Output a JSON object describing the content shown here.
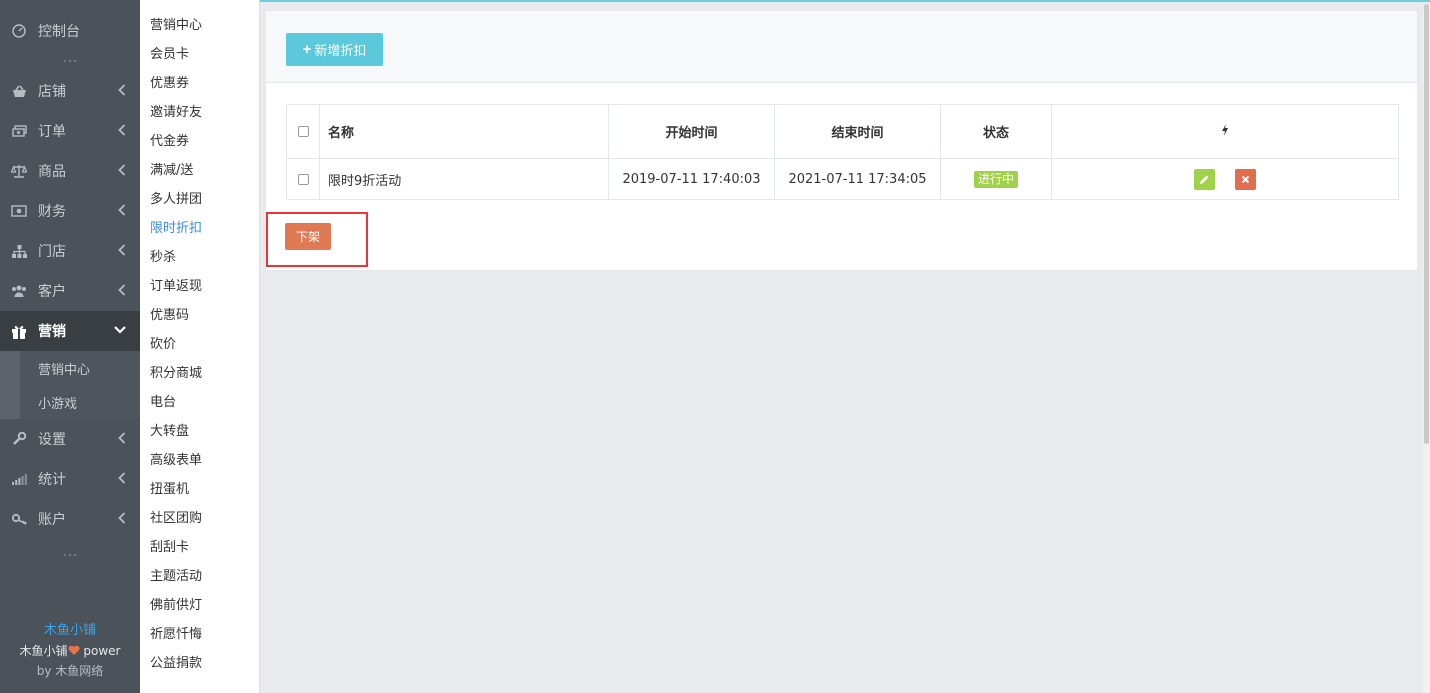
{
  "sidebar": {
    "top_item": {
      "label": "控制台",
      "icon": "dashboard-icon"
    },
    "items": [
      {
        "label": "店铺",
        "icon": "basket-icon"
      },
      {
        "label": "订单",
        "icon": "money-icon"
      },
      {
        "label": "商品",
        "icon": "scale-icon"
      },
      {
        "label": "财务",
        "icon": "cash-icon"
      },
      {
        "label": "门店",
        "icon": "sitemap-icon"
      },
      {
        "label": "客户",
        "icon": "users-icon"
      }
    ],
    "active_item": {
      "label": "营销",
      "icon": "gift-icon"
    },
    "sub_items": [
      {
        "label": "营销中心"
      },
      {
        "label": "小游戏"
      }
    ],
    "bottom_items": [
      {
        "label": "设置",
        "icon": "wrench-icon"
      },
      {
        "label": "统计",
        "icon": "signal-icon"
      },
      {
        "label": "账户",
        "icon": "key-icon"
      }
    ],
    "footer": {
      "brand": "木鱼小铺",
      "line2": "木鱼小铺",
      "line2_suffix": " power",
      "line3": "by 木鱼网络"
    }
  },
  "subnav": {
    "items": [
      "营销中心",
      "会员卡",
      "优惠券",
      "邀请好友",
      "代金券",
      "满减/送",
      "多人拼团",
      "限时折扣",
      "秒杀",
      "订单返现",
      "优惠码",
      "砍价",
      "积分商城",
      "电台",
      "大转盘",
      "高级表单",
      "扭蛋机",
      "社区团购",
      "刮刮卡",
      "主题活动",
      "佛前供灯",
      "祈愿忏悔",
      "公益捐款"
    ],
    "active": "限时折扣"
  },
  "main": {
    "add_button": "新增折扣",
    "table": {
      "headers": {
        "name": "名称",
        "start": "开始时间",
        "end": "结束时间",
        "status": "状态",
        "ops": "bolt-icon"
      },
      "rows": [
        {
          "name": "限时9折活动",
          "start": "2019-07-11 17:40:03",
          "end": "2021-07-11 17:34:05",
          "status": "进行中"
        }
      ]
    },
    "offline_button": "下架"
  },
  "colors": {
    "sidebar_bg": "#4c5259",
    "accent": "#5bc8db",
    "active_link": "#3c8dde",
    "status_green": "#9fd14a",
    "danger": "#e06d4e",
    "highlight": "#ee3333"
  }
}
